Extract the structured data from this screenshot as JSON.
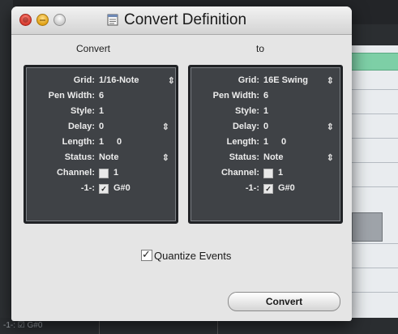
{
  "window": {
    "title": "Convert Definition"
  },
  "headers": {
    "left": "Convert",
    "right": "to"
  },
  "left_panel": {
    "grid": {
      "label": "Grid:",
      "value": "1/16-Note"
    },
    "pen_width": {
      "label": "Pen Width:",
      "value": "6"
    },
    "style": {
      "label": "Style:",
      "value": "1"
    },
    "delay": {
      "label": "Delay:",
      "value": "0"
    },
    "length": {
      "label": "Length:",
      "value": "1",
      "value2": "0"
    },
    "status": {
      "label": "Status:",
      "value": "Note"
    },
    "channel": {
      "label": "Channel:",
      "value": "1"
    },
    "pitch": {
      "label": "-1-:",
      "value": "G#0"
    }
  },
  "right_panel": {
    "grid": {
      "label": "Grid:",
      "value": "16E Swing"
    },
    "pen_width": {
      "label": "Pen Width:",
      "value": "6"
    },
    "style": {
      "label": "Style:",
      "value": "1"
    },
    "delay": {
      "label": "Delay:",
      "value": "0"
    },
    "length": {
      "label": "Length:",
      "value": "1",
      "value2": "0"
    },
    "status": {
      "label": "Status:",
      "value": "Note"
    },
    "channel": {
      "label": "Channel:",
      "value": "1"
    },
    "pitch": {
      "label": "-1-:",
      "value": "G#0"
    }
  },
  "quantize": {
    "label": "Quantize Events",
    "checked": true
  },
  "convert_button": {
    "label": "Convert"
  },
  "background": {
    "bottom_label": "-1-: ☑ G#0"
  }
}
